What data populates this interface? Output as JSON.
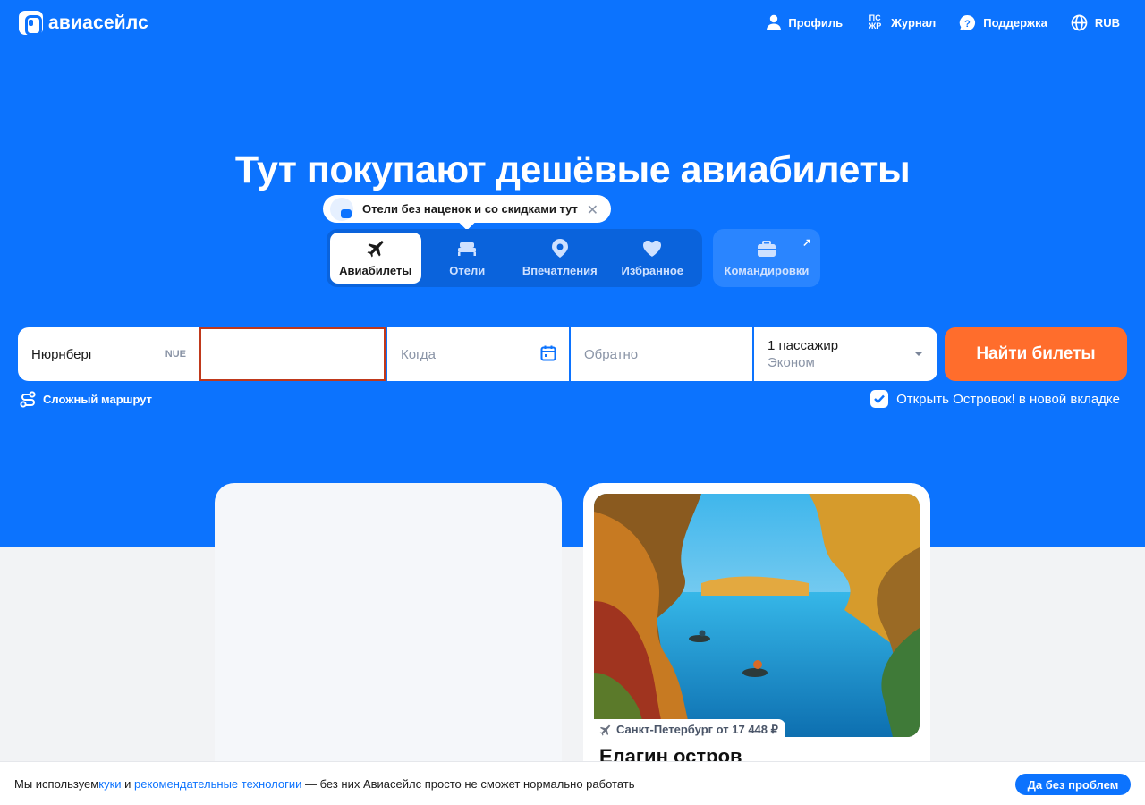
{
  "header": {
    "logo_text": "авиасейлс",
    "nav": [
      {
        "label": "Профиль",
        "icon": "user-icon"
      },
      {
        "label": "Журнал",
        "icon": "journal-icon",
        "mark_top": "ПС",
        "mark_bottom": "ЖР"
      },
      {
        "label": "Поддержка",
        "icon": "help-icon"
      },
      {
        "label": "RUB",
        "icon": "globe-icon"
      }
    ]
  },
  "hero": {
    "title": "Тут покупают дешёвые авиабилеты",
    "promo": {
      "text": "Отели без наценок и со скидками тут",
      "close": "✕"
    }
  },
  "tabs": [
    {
      "label": "Авиабилеты",
      "icon": "plane-icon",
      "active": true
    },
    {
      "label": "Отели",
      "icon": "bed-icon",
      "active": false
    },
    {
      "label": "Впечатления",
      "icon": "pin-icon",
      "active": false
    },
    {
      "label": "Избранное",
      "icon": "heart-icon",
      "active": false
    }
  ],
  "trips_tab": {
    "label": "Командировки",
    "icon": "briefcase-icon",
    "arrow": "↗"
  },
  "search": {
    "origin": {
      "value": "Нюрнберг",
      "code": "NUE"
    },
    "destination": {
      "value": ""
    },
    "when": {
      "placeholder": "Когда"
    },
    "back": {
      "placeholder": "Обратно"
    },
    "passengers": {
      "count": "1 пассажир",
      "class": "Эконом"
    },
    "submit": "Найти билеты",
    "complex_route": "Сложный маршрут",
    "open_tab": "Открыть Островок! в новой вкладке",
    "open_tab_checked": true
  },
  "card": {
    "price": "Санкт-Петербург от 17 448 ₽",
    "title": "Елагин остров"
  },
  "cookie": {
    "text_before": "Мы используем ",
    "link1": "куки",
    "and": " и ",
    "link2": "рекомендательные технологии",
    "text_after": " — без них Авиасейлс просто не сможет нормально работать",
    "button": "Да без проблем"
  },
  "colors": {
    "brand_blue": "#0c73fe",
    "accent_orange": "#ff6d2c"
  }
}
